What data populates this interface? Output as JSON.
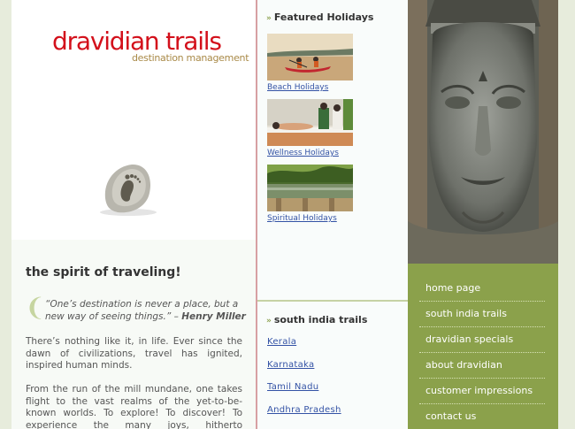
{
  "brand": {
    "name": "dravidian trails",
    "tagline": "destination management"
  },
  "intro": {
    "heading": "the spirit of traveling!",
    "quote": "“One’s destination is never a place, but a new way of seeing things.” –",
    "quote_author": "Henry Miller",
    "para1": "There’s nothing like it, in life. Ever since the dawn of civilizations, travel has ignited, inspired human minds.",
    "para2": "From the run of the mill mundane, one takes flight to the vast realms of the yet-to-be-known worlds. To explore! To discover! To experience the many joys, hitherto unsavoured!!!"
  },
  "featured": {
    "title": "Featured Holidays",
    "items": [
      {
        "label": "Beach Holidays"
      },
      {
        "label": "Wellness Holidays"
      },
      {
        "label": "Spiritual Holidays"
      }
    ]
  },
  "trails": {
    "title": "south india trails",
    "items": [
      "Kerala",
      "Karnataka",
      "Tamil Nadu",
      "Andhra Pradesh"
    ]
  },
  "nav": {
    "items": [
      "home page",
      "south india trails",
      "dravidian specials",
      "about dravidian",
      "customer impressions",
      "contact us"
    ]
  },
  "colors": {
    "brand_red": "#d3101b",
    "nav_green": "#8ba14b",
    "link_blue": "#3352a5"
  }
}
